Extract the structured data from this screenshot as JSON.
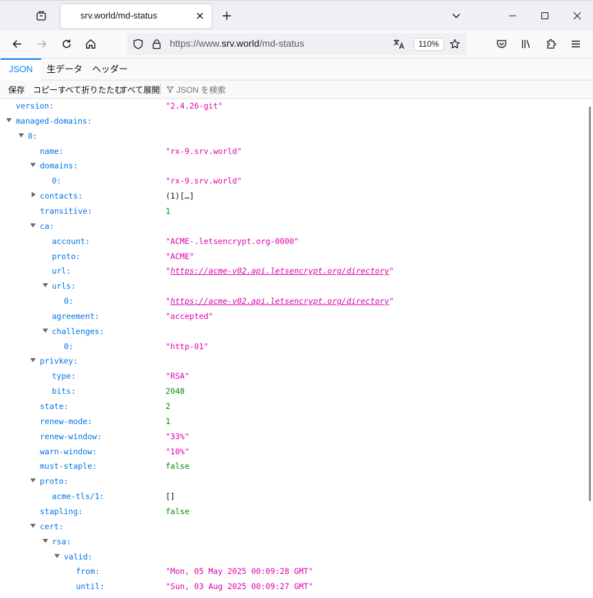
{
  "tab": {
    "title": "srv.world/md-status"
  },
  "urlbar": {
    "prefix": "https://www.",
    "host": "srv.world",
    "path": "/md-status",
    "zoom": "110%"
  },
  "viewer": {
    "tabs": [
      "JSON",
      "生データ",
      "ヘッダー"
    ],
    "toolbar": {
      "save": "保存",
      "copy": "コピー",
      "collapse_all": "すべて折りたたむ",
      "expand_all": "すべて展開",
      "filter_placeholder": "JSON を検索"
    }
  },
  "tree": [
    {
      "key": "version:",
      "value": "\"2.4.26-git\"",
      "type": "str",
      "twisty": ""
    },
    {
      "key": "managed-domains:",
      "value": "",
      "type": "",
      "twisty": "open"
    },
    {
      "key": "0:",
      "value": "",
      "type": "",
      "twisty": "open"
    },
    {
      "key": "name:",
      "value": "\"rx-9.srv.world\"",
      "type": "str",
      "twisty": ""
    },
    {
      "key": "domains:",
      "value": "",
      "type": "",
      "twisty": "open"
    },
    {
      "key": "0:",
      "value": "\"rx-9.srv.world\"",
      "type": "str",
      "twisty": ""
    },
    {
      "key": "contacts:",
      "value": "(1)[…]",
      "type": "plain",
      "twisty": "closed"
    },
    {
      "key": "transitive:",
      "value": "1",
      "type": "num",
      "twisty": ""
    },
    {
      "key": "ca:",
      "value": "",
      "type": "",
      "twisty": "open"
    },
    {
      "key": "account:",
      "value": "\"ACME-.letsencrypt.org-0000\"",
      "type": "str",
      "twisty": ""
    },
    {
      "key": "proto:",
      "value": "\"ACME\"",
      "type": "str",
      "twisty": ""
    },
    {
      "key": "url:",
      "value": "https://acme-v02.api.letsencrypt.org/directory",
      "type": "link",
      "twisty": ""
    },
    {
      "key": "urls:",
      "value": "",
      "type": "",
      "twisty": "open"
    },
    {
      "key": "0:",
      "value": "https://acme-v02.api.letsencrypt.org/directory",
      "type": "link",
      "twisty": ""
    },
    {
      "key": "agreement:",
      "value": "\"accepted\"",
      "type": "str",
      "twisty": ""
    },
    {
      "key": "challenges:",
      "value": "",
      "type": "",
      "twisty": "open"
    },
    {
      "key": "0:",
      "value": "\"http-01\"",
      "type": "str",
      "twisty": ""
    },
    {
      "key": "privkey:",
      "value": "",
      "type": "",
      "twisty": "open"
    },
    {
      "key": "type:",
      "value": "\"RSA\"",
      "type": "str",
      "twisty": ""
    },
    {
      "key": "bits:",
      "value": "2048",
      "type": "num",
      "twisty": ""
    },
    {
      "key": "state:",
      "value": "2",
      "type": "num",
      "twisty": ""
    },
    {
      "key": "renew-mode:",
      "value": "1",
      "type": "num",
      "twisty": ""
    },
    {
      "key": "renew-window:",
      "value": "\"33%\"",
      "type": "str",
      "twisty": ""
    },
    {
      "key": "warn-window:",
      "value": "\"10%\"",
      "type": "str",
      "twisty": ""
    },
    {
      "key": "must-staple:",
      "value": "false",
      "type": "bool",
      "twisty": ""
    },
    {
      "key": "proto:",
      "value": "",
      "type": "",
      "twisty": "open"
    },
    {
      "key": "acme-tls/1:",
      "value": "[]",
      "type": "plain",
      "twisty": ""
    },
    {
      "key": "stapling:",
      "value": "false",
      "type": "bool",
      "twisty": ""
    },
    {
      "key": "cert:",
      "value": "",
      "type": "",
      "twisty": "open"
    },
    {
      "key": "rsa:",
      "value": "",
      "type": "",
      "twisty": "open"
    },
    {
      "key": "valid:",
      "value": "",
      "type": "",
      "twisty": "open"
    },
    {
      "key": "from:",
      "value": "\"Mon, 05 May 2025 00:09:28 GMT\"",
      "type": "str",
      "twisty": ""
    },
    {
      "key": "until:",
      "value": "\"Sun, 03 Aug 2025 00:09:27 GMT\"",
      "type": "str",
      "twisty": ""
    }
  ],
  "colors": {
    "key": "#0074e8",
    "string": "#dd00a9",
    "number": "#058b00",
    "accent": "#0a84ff"
  }
}
